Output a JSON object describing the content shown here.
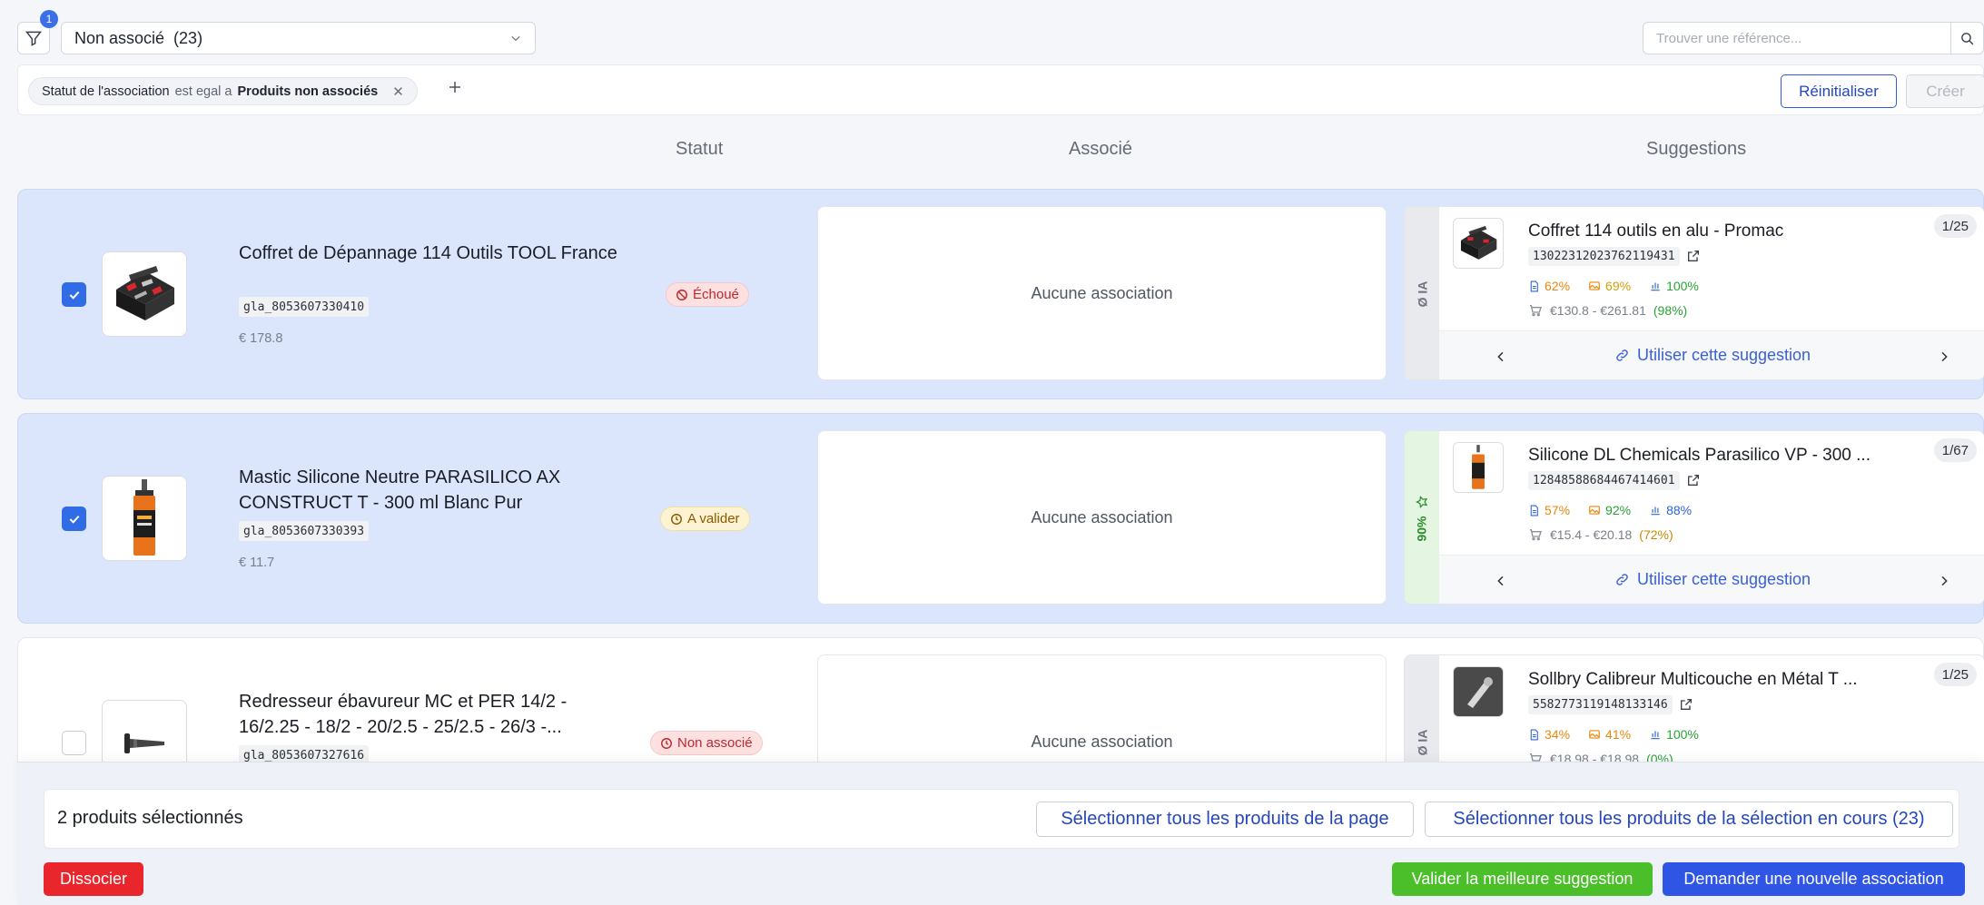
{
  "toolbar": {
    "filter_badge": "1",
    "select_value": "Non associé  (23)",
    "search_placeholder": "Trouver une référence..."
  },
  "filters": {
    "chip_field": "Statut de l'association",
    "chip_operator": "est egal a",
    "chip_value": "Produits non associés",
    "reset_label": "Réinitialiser",
    "create_label": "Créer"
  },
  "columns": {
    "status": "Statut",
    "associated": "Associé",
    "suggestions": "Suggestions"
  },
  "rows": [
    {
      "selected": true,
      "name": "Coffret de Dépannage 114 Outils TOOL France",
      "sku": "gla_8053607330410",
      "price": "€ 178.8",
      "status": "Échoué",
      "status_type": "fail",
      "association": "Aucune association",
      "suggestion": {
        "side_label": "Ø IA",
        "side_type": "grey",
        "title": "Coffret 114 outils en alu - Promac",
        "code": "1302231202376211943​1",
        "counter": "1/25",
        "m_text": "62%",
        "m_image": "69%",
        "m_chart": "100%",
        "price_range": "€130.8 - €261.81",
        "price_pct": "(98%)",
        "price_pct_color": "green",
        "use_label": "Utiliser cette suggestion"
      }
    },
    {
      "selected": true,
      "name": "Mastic Silicone Neutre PARASILICO AX CONSTRUCT T - 300 ml Blanc Pur",
      "sku": "gla_8053607330393",
      "price": "€ 11.7",
      "status": "A valider",
      "status_type": "pending",
      "association": "Aucune association",
      "suggestion": {
        "side_label": "90%",
        "side_type": "green",
        "title": "Silicone DL Chemicals Parasilico VP - 300 ...",
        "code": "12848588684467414601",
        "counter": "1/67",
        "m_text": "57%",
        "m_image": "92%",
        "m_chart": "88%",
        "price_range": "€15.4 - €20.18",
        "price_pct": "(72%)",
        "price_pct_color": "amber",
        "use_label": "Utiliser cette suggestion"
      }
    },
    {
      "selected": false,
      "name": "Redresseur ébavureur MC et PER 14/2 - 16/2.25 - 18/2 - 20/2.5 - 25/2.5 - 26/3 -...",
      "sku": "gla_8053607327616",
      "price": "",
      "status": "Non associé",
      "status_type": "fail",
      "association": "Aucune association",
      "suggestion": {
        "side_label": "Ø IA",
        "side_type": "grey",
        "title": "Sollbry Calibreur Multicouche en Métal T ...",
        "code": "5582773119148133146",
        "counter": "1/25",
        "m_text": "34%",
        "m_image": "41%",
        "m_chart": "100%",
        "price_range": "€18.98 - €18.98",
        "price_pct": "(0%)",
        "price_pct_color": "green",
        "use_label": "Utiliser cette suggestion"
      }
    }
  ],
  "bottom": {
    "selected_count": "2 produits sélectionnés",
    "select_page": "Sélectionner tous les produits de la page",
    "select_all": "Sélectionner tous les produits de la sélection en cours (23)",
    "dissociate": "Dissocier",
    "validate_best": "Valider la meilleure suggestion",
    "request_new": "Demander une nouvelle association"
  },
  "colors": {
    "primary": "#2f5bd9",
    "selected_row": "#dbe6fd",
    "fail": "#c0262d",
    "pending": "#8a5a00",
    "danger_button": "#e8262c",
    "success_button": "#4bbf2a",
    "primary_button": "#2f55e4"
  },
  "icons": [
    "filter-icon",
    "chevron-down-icon",
    "search-icon",
    "close-icon",
    "plus-icon",
    "check-icon",
    "ban-icon",
    "clock-icon",
    "external-link-icon",
    "document-icon",
    "image-icon",
    "bar-chart-icon",
    "cart-icon",
    "link-icon",
    "chevron-left-icon",
    "chevron-right-icon",
    "star-icon"
  ]
}
